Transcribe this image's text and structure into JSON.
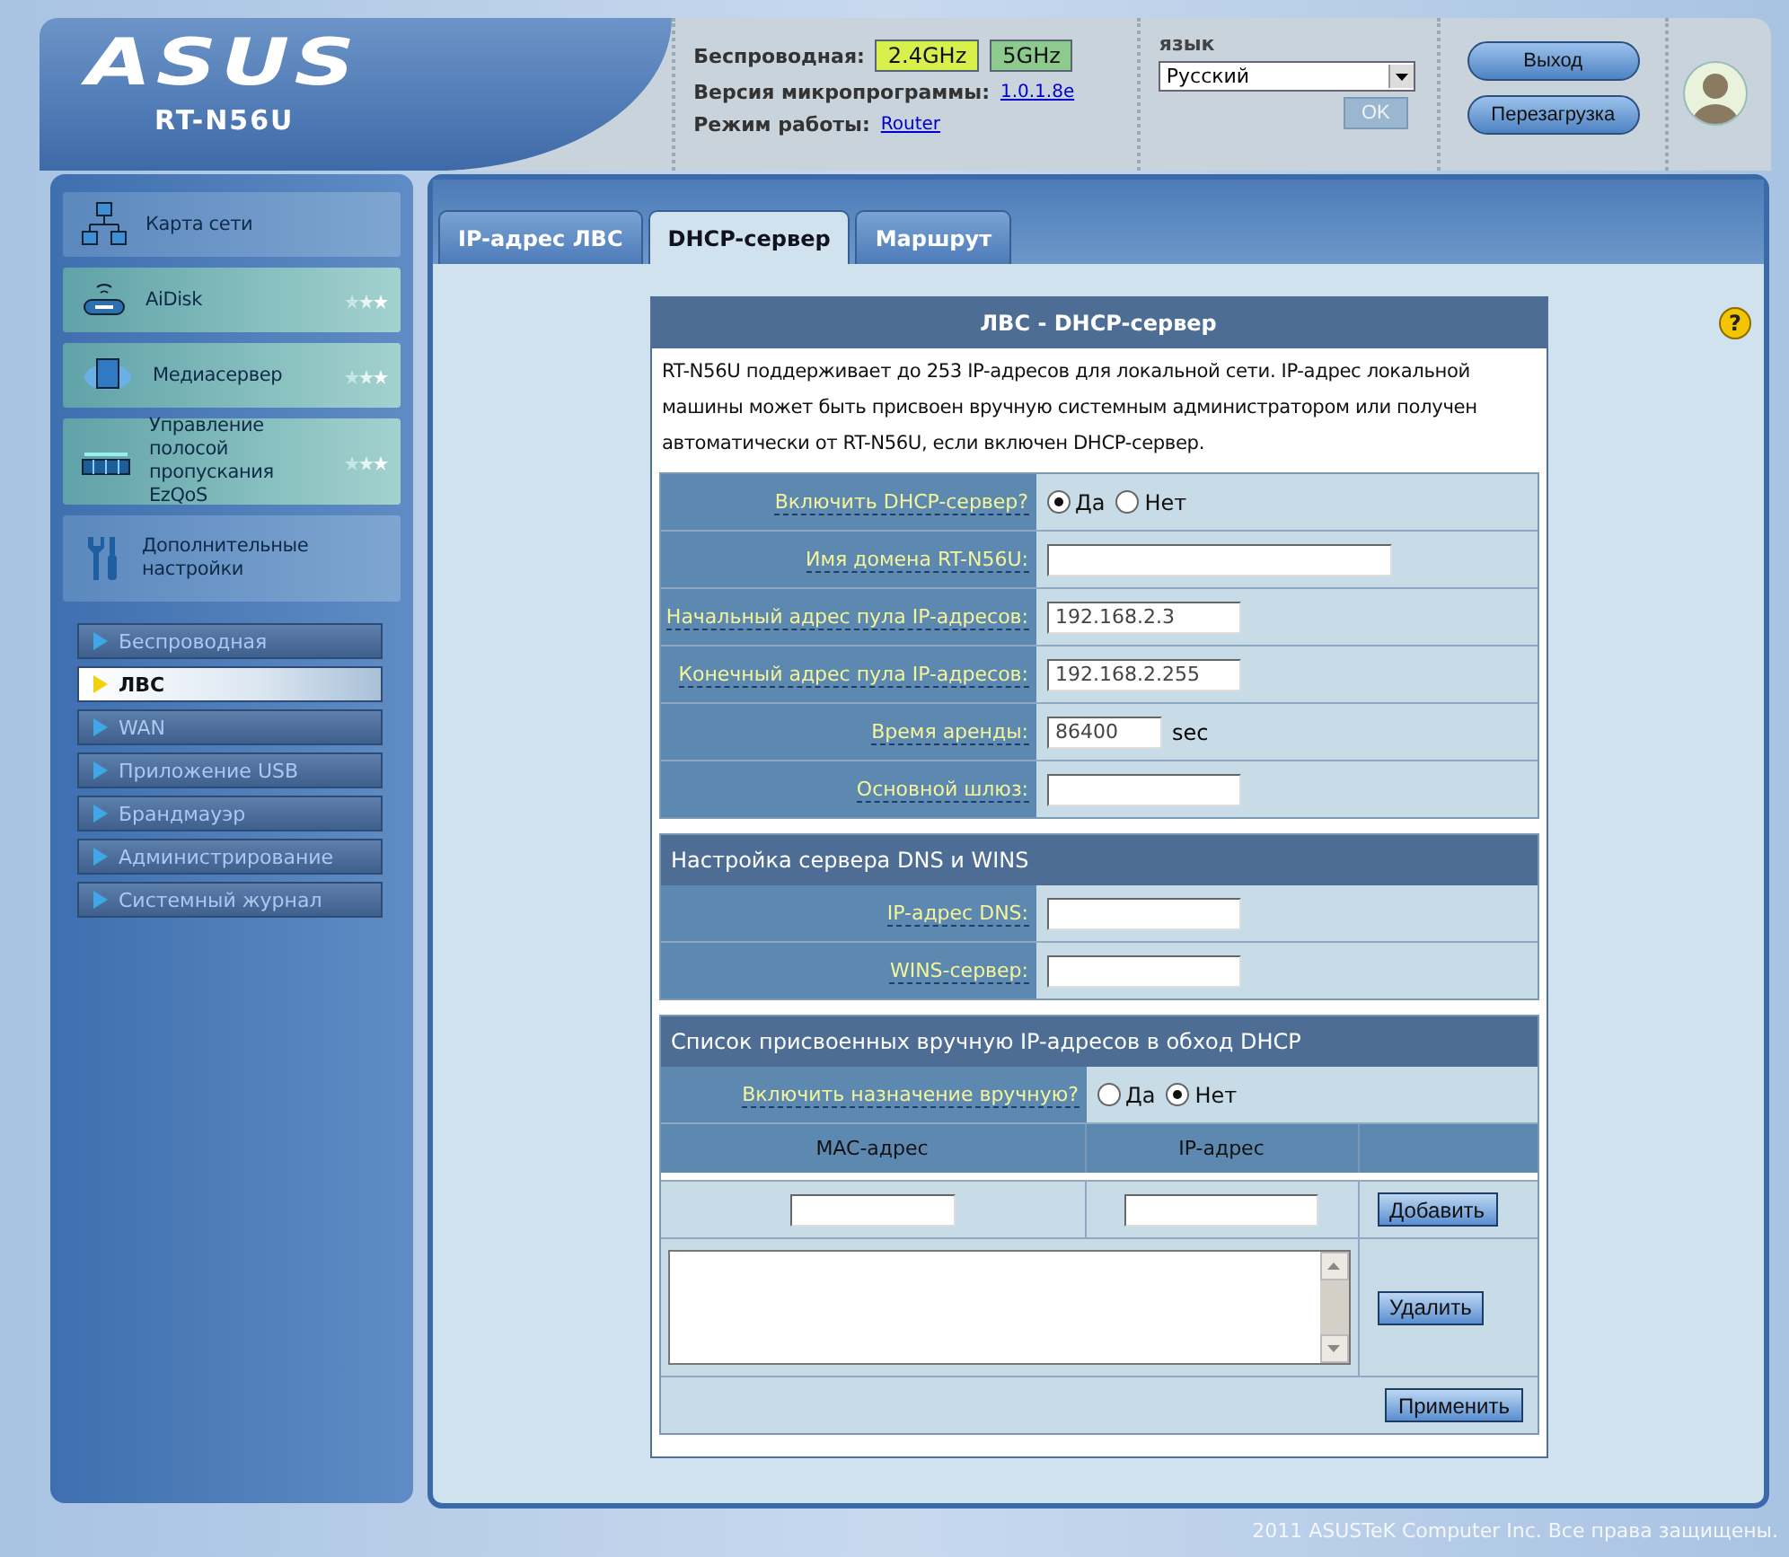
{
  "header": {
    "logo": "ASUS",
    "model": "RT-N56U",
    "wireless_label": "Беспроводная:",
    "bands": [
      {
        "label": "2.4GHz",
        "selected": true
      },
      {
        "label": "5GHz",
        "selected": false
      }
    ],
    "firmware_label": "Версия микропрограммы:",
    "firmware_value": "1.0.1.8e",
    "mode_label": "Режим работы:",
    "mode_value": "Router",
    "language_label": "язык",
    "language_value": "Русский",
    "ok_button": {
      "label": "OK",
      "disabled": true
    },
    "logout_button": "Выход",
    "reboot_button": "Перезагрузка"
  },
  "sidebar": {
    "items": [
      {
        "label": "Карта сети",
        "starred": false
      },
      {
        "label": "AiDisk",
        "starred": true
      },
      {
        "label": "Медиасервер",
        "starred": true
      },
      {
        "label": "Управление полосой пропускания EzQoS",
        "starred": true
      },
      {
        "label": "Дополнительные настройки",
        "starred": false
      }
    ],
    "submenu": [
      {
        "label": "Беспроводная",
        "selected": false
      },
      {
        "label": "ЛВС",
        "selected": true
      },
      {
        "label": "WAN",
        "selected": false
      },
      {
        "label": "Приложение USB",
        "selected": false
      },
      {
        "label": "Брандмауэр",
        "selected": false
      },
      {
        "label": "Администрирование",
        "selected": false
      },
      {
        "label": "Системный журнал",
        "selected": false
      }
    ]
  },
  "tabs": [
    {
      "label": "IP-адрес ЛВС",
      "selected": false
    },
    {
      "label": "DHCP-сервер",
      "selected": true
    },
    {
      "label": "Маршрут",
      "selected": false
    }
  ],
  "help": "?",
  "form": {
    "title": "ЛВС - DHCP-сервер",
    "description": "RT-N56U поддерживает до 253 IP-адресов для локальной сети. IP-адрес локальной машины может быть присвоен вручную системным администратором или получен автоматически от RT-N56U, если включен DHCP-сервер.",
    "rows": [
      {
        "kind": "radio",
        "label": "Включить DHCP-сервер?",
        "options": [
          {
            "label": "Да",
            "selected": true
          },
          {
            "label": "Нет",
            "selected": false
          }
        ]
      },
      {
        "kind": "wide_input",
        "label": "Имя домена RT-N56U:"
      },
      {
        "kind": "input",
        "label": "Начальный адрес пула IP-адресов:",
        "value": "192.168.2.3"
      },
      {
        "kind": "input",
        "label": "Конечный адрес пула IP-адресов:",
        "value": "192.168.2.255"
      },
      {
        "kind": "short_input",
        "label": "Время аренды:",
        "value": "86400",
        "unit": "sec"
      },
      {
        "kind": "input",
        "label": "Основной шлюз:"
      }
    ],
    "dns_title": "Настройка сервера DNS и WINS",
    "dns_rows": [
      {
        "kind": "input",
        "label": "IP-адрес DNS:"
      },
      {
        "kind": "input",
        "label": "WINS-сервер:"
      }
    ],
    "manual_title": "Список присвоенных вручную IP-адресов в обход DHCP",
    "manual_enable": {
      "label": "Включить назначение вручную?",
      "options": [
        {
          "label": "Да",
          "selected": false
        },
        {
          "label": "Нет",
          "selected": true
        }
      ]
    },
    "columns": [
      "MAC-адрес",
      "IP-адрес"
    ],
    "add_button": "Добавить",
    "delete_button": "Удалить",
    "apply_button": "Применить"
  },
  "footer": "2011 ASUSTeK Computer Inc. Все права защищены."
}
